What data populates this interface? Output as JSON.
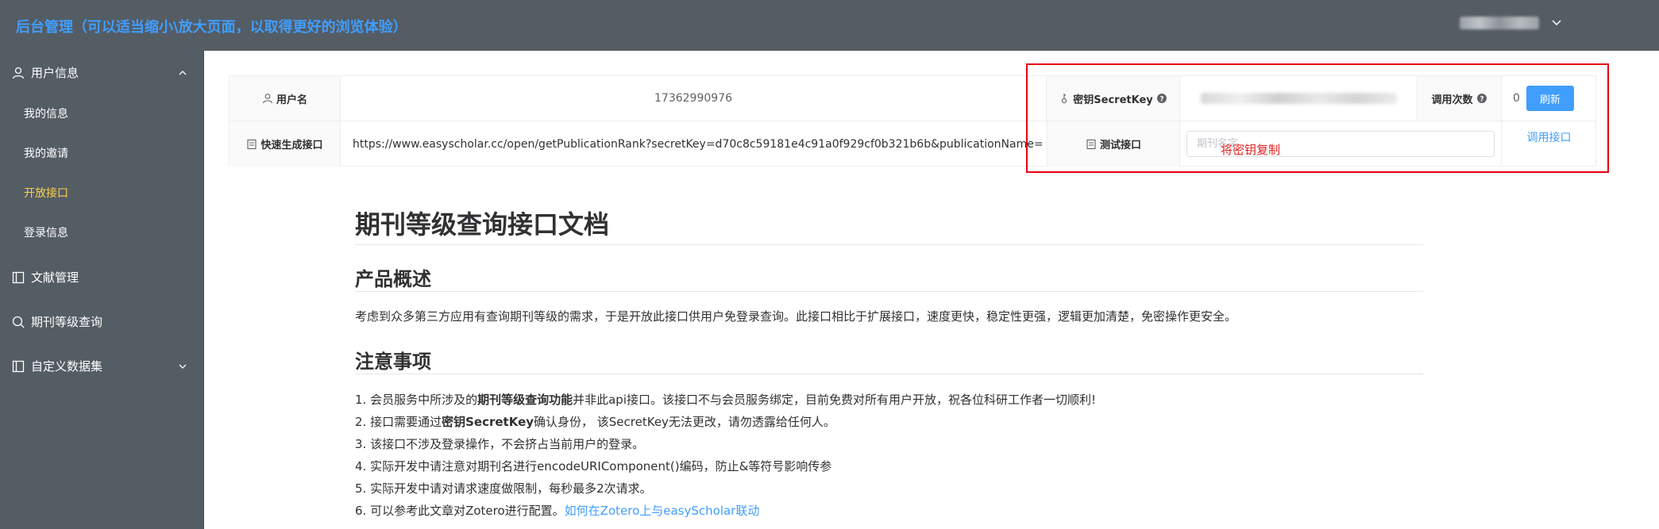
{
  "header": {
    "title": "后台管理（可以适当缩小\\放大页面，以取得更好的浏览体验）"
  },
  "sidebar": {
    "groups": [
      {
        "label": "用户信息",
        "icon": "user-icon",
        "expanded": true
      },
      {
        "label": "文献管理",
        "icon": "document-icon"
      },
      {
        "label": "期刊等级查询",
        "icon": "search-icon"
      },
      {
        "label": "自定义数据集",
        "icon": "document-icon",
        "expandable": true
      }
    ],
    "sub_items": [
      "我的信息",
      "我的邀请",
      "开放接口",
      "登录信息"
    ],
    "active_sub": "开放接口",
    "active_color": "#ffd04b"
  },
  "info_table": {
    "username_label": "用户名",
    "username_value": "17362990976",
    "secret_key_label": "密钥SecretKey",
    "call_count_label": "调用次数",
    "call_count_value": "0",
    "refresh_label": "刷新",
    "quick_gen_label": "快速生成接口",
    "quick_gen_url": "https://www.easyscholar.cc/open/getPublicationRank?secretKey=d70c8c59181e4c91a0f929cf0b321b6b&publicationName=",
    "test_label": "测试接口",
    "journal_placeholder": "期刊名字",
    "call_link": "调用接口"
  },
  "annotation": {
    "hint": "将密钥复制",
    "color": "#e60012"
  },
  "doc": {
    "title": "期刊等级查询接口文档",
    "section1": "产品概述",
    "overview": "考虑到众多第三方应用有查询期刊等级的需求，于是开放此接口供用户免登录查询。此接口相比于扩展接口，速度更快，稳定性更强，逻辑更加清楚，免密操作更安全。",
    "section2": "注意事项",
    "notes": [
      {
        "pre": "1. 会员服务中所涉及的",
        "bold": "期刊等级查询功能",
        "post": "并非此api接口。该接口不与会员服务绑定，目前免费对所有用户开放，祝各位科研工作者一切顺利!"
      },
      {
        "pre": "2. 接口需要通过",
        "bold": "密钥SecretKey",
        "post": "确认身份，  该SecretKey无法更改，请勿透露给任何人。"
      },
      {
        "pre": "3. 该接口不涉及登录操作，不会挤占当前用户的登录。",
        "bold": "",
        "post": ""
      },
      {
        "pre": "4. 实际开发中请注意对期刊名进行encodeURIComponent()编码，防止&等符号影响传参",
        "bold": "",
        "post": ""
      },
      {
        "pre": "5. 实际开发中请对请求速度做限制，每秒最多2次请求。",
        "bold": "",
        "post": ""
      }
    ],
    "note6_pre": "6. 可以参考此文章对Zotero进行配置。",
    "note6_link": "如何在Zotero上与easyScholar联动"
  },
  "colors": {
    "header_bg": "#545c64",
    "accent": "#409eff"
  }
}
